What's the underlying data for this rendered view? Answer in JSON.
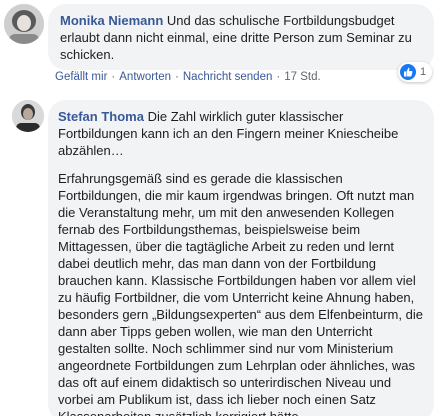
{
  "comments": [
    {
      "author": "Monika Niemann",
      "text": " Und das schulische Fortbildungsbudget erlaubt dann nicht einmal, eine dritte Person zum Seminar zu schicken.",
      "actions": {
        "like": "Gefällt mir",
        "reply": "Antworten",
        "message": "Nachricht senden",
        "time": "17 Std."
      },
      "reaction": {
        "icon": "like-icon",
        "count": "1",
        "color": "#1877f2"
      }
    },
    {
      "author": "Stefan Thoma",
      "intro": " Die Zahl wirklich guter klassischer Fortbildungen kann ich an den Fingern meiner Kniescheibe abzählen…",
      "body": "Erfahrungsgemäß sind es gerade die klassischen Fortbildungen, die mir kaum irgendwas bringen. Oft nutzt man die Veranstaltung mehr, um mit den anwesenden Kollegen fernab des Fortbildungsthemas, beispielsweise beim Mittagessen, über die tagtägliche Arbeit zu reden und lernt dabei deutlich mehr, das man dann von der Fortbildung brauchen kann. Klassische Fortbildungen haben vor allem viel zu häufig Fortbildner, die vom Unterricht keine Ahnung haben, besonders gern „Bildungsexperten“ aus dem Elfenbeinturm, die dann aber Tipps geben wollen, wie man den Unterricht gestalten sollte. Noch schlimmer sind nur vom Ministerium angeordnete Fortbildungen zum Lehrplan oder ähnliches, was das oft auf einem didaktisch so unterirdischen Niveau und vorbei am Publikum ist, dass ich lieber noch einen Satz Klassenarbeiten zusätzlich korrigiert hätte."
    }
  ],
  "colors": {
    "author": "#385898",
    "bubble": "#f2f3f5",
    "meta": "#606770"
  }
}
